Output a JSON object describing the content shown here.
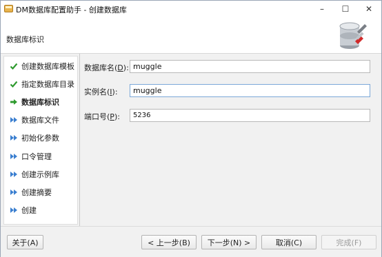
{
  "window": {
    "title": "DM数据库配置助手 - 创建数据库",
    "minimize": "–",
    "maximize": "☐",
    "close": "✕"
  },
  "header": {
    "title": "数据库标识",
    "icon": "database-wrench-icon"
  },
  "sidebar": {
    "items": [
      {
        "label": "创建数据库模板",
        "status": "done",
        "icon": "check-icon"
      },
      {
        "label": "指定数据库目录",
        "status": "done",
        "icon": "check-icon"
      },
      {
        "label": "数据库标识",
        "status": "current",
        "icon": "arrow-right-icon"
      },
      {
        "label": "数据库文件",
        "status": "pending",
        "icon": "double-arrow-icon"
      },
      {
        "label": "初始化参数",
        "status": "pending",
        "icon": "double-arrow-icon"
      },
      {
        "label": "口令管理",
        "status": "pending",
        "icon": "double-arrow-icon"
      },
      {
        "label": "创建示例库",
        "status": "pending",
        "icon": "double-arrow-icon"
      },
      {
        "label": "创建摘要",
        "status": "pending",
        "icon": "double-arrow-icon"
      },
      {
        "label": "创建",
        "status": "pending",
        "icon": "double-arrow-icon"
      }
    ]
  },
  "form": {
    "db_name": {
      "label_pre": "数据库名(",
      "mnemonic": "D",
      "label_post": "):",
      "value": "muggle"
    },
    "instance_name": {
      "label_pre": "实例名(",
      "mnemonic": "I",
      "label_post": "):",
      "value": "muggle"
    },
    "port": {
      "label_pre": "端口号(",
      "mnemonic": "P",
      "label_post": "):",
      "value": "5236"
    }
  },
  "buttons": {
    "about": "关于(A)",
    "prev": "< 上一步(B)",
    "next": "下一步(N) >",
    "cancel": "取消(C)",
    "finish": "完成(F)"
  },
  "colors": {
    "check": "#2e9a2e",
    "current_arrow": "#2e9a2e",
    "pending_arrow": "#3b7fd0",
    "focus_border": "#7aa7d8"
  }
}
